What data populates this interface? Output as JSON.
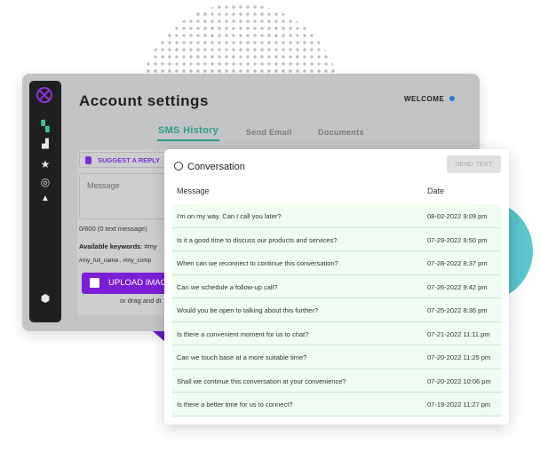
{
  "app": {
    "title": "Account settings",
    "welcome": "WELCOME"
  },
  "sidebar": {
    "items": [
      {
        "name": "logo-icon"
      },
      {
        "name": "dashboard-icon",
        "glyph": "▚"
      },
      {
        "name": "chart-icon",
        "glyph": "▟"
      },
      {
        "name": "star-icon",
        "glyph": "★"
      },
      {
        "name": "circle-icon",
        "glyph": "◎"
      },
      {
        "name": "triangle-icon",
        "glyph": "▲"
      },
      {
        "name": "settings-icon",
        "glyph": "⬢"
      }
    ]
  },
  "tabs": [
    {
      "label": "SMS History",
      "active": true
    },
    {
      "label": "Send Email"
    },
    {
      "label": "Documents"
    }
  ],
  "compose": {
    "suggest_label": "SUGGEST A REPLY",
    "message_placeholder": "Message",
    "counter": "0/600 (0 text message)",
    "keywords_label": "Available keywords",
    "keywords_line1": ":  #my",
    "keywords_line2": "#my_full_name , #my_comp",
    "upload_label": "UPLOAD IMAGE",
    "drag_text": "or drag and dr"
  },
  "conversation": {
    "title": "Conversation",
    "send_label": "SEND TEXT",
    "columns": [
      "Message",
      "Date"
    ],
    "rows": [
      {
        "message": "I'm on my way. Can I call you later?",
        "date": "08-02-2022 9:09 pm"
      },
      {
        "message": "Is it a good time to discuss our products and services?",
        "date": "07-29-2022 9:50 pm"
      },
      {
        "message": "When can we reconnect to continue this conversation?",
        "date": "07-28-2022 8:37 pm"
      },
      {
        "message": "Can we schedule a follow-up call?",
        "date": "07-26-2022 9:42 pm"
      },
      {
        "message": "Would you be open to talking about this further?",
        "date": "07-25-2022 8:36 pm"
      },
      {
        "message": "Is there a convenient moment for us to chat?",
        "date": "07-21-2022 11:11 pm"
      },
      {
        "message": "Can we touch base at a more suitable time?",
        "date": "07-20-2022 11:25 pm"
      },
      {
        "message": "Shall we continue this conversation at your convenience?",
        "date": "07-20-2022 10:06 pm"
      },
      {
        "message": "Is there a better time for us to connect?",
        "date": "07-19-2022 11:27 pm"
      }
    ]
  },
  "colors": {
    "accent_green": "#2a9e7e",
    "accent_purple": "#7a1fd6",
    "status_blue": "#1c7fd6"
  }
}
